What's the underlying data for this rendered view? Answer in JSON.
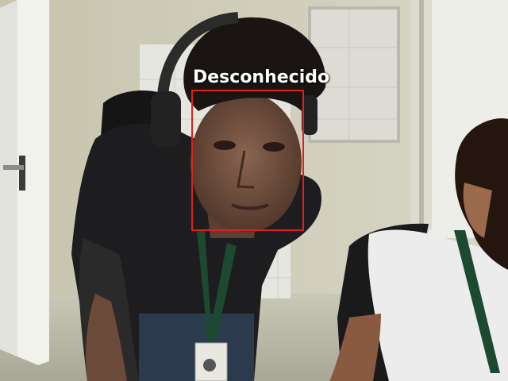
{
  "detection": {
    "label": "Desconhecido",
    "box_color": "#e0201c",
    "label_color": "#ffffff"
  }
}
